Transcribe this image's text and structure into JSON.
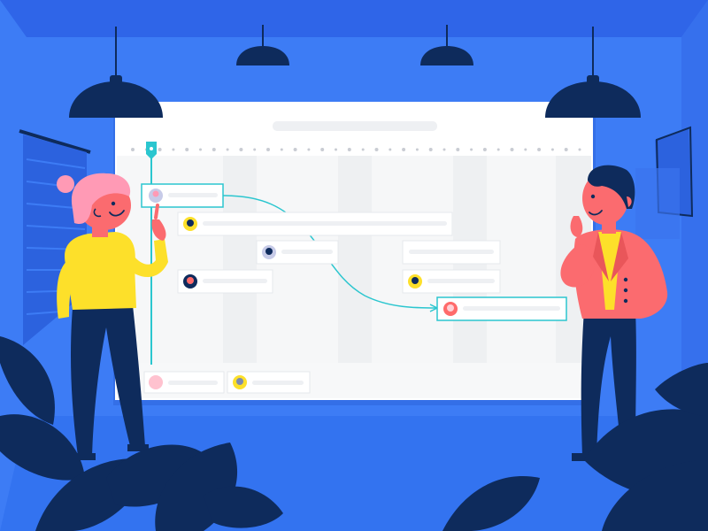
{
  "colors": {
    "background": "#3d7cf5",
    "ceiling": "#2f65e8",
    "floor": "#3373f0",
    "navy": "#0e2b5c",
    "board": "#ffffff",
    "board_lane": "#f3f4f6",
    "accent": "#2bc6cf",
    "yellow": "#fde02a",
    "pink": "#ff6b6b",
    "coral": "#fb6b6f"
  },
  "icons": {
    "pendant_lamps": "lamp-icon",
    "avatars": "avatar-icon",
    "plants": "plant-icon"
  },
  "board": {
    "timeline_marker_count": 34,
    "has_search_bar_placeholder": true
  },
  "people": [
    {
      "role": "woman-pointing",
      "hair": "#ff9ab5",
      "shirt": "#fde02a",
      "pants": "#0e2b5c"
    },
    {
      "role": "man-thinking",
      "hair": "#0e2b5c",
      "jacket": "#fb6b6f",
      "shirt": "#fde02a",
      "pants": "#0e2b5c"
    }
  ]
}
